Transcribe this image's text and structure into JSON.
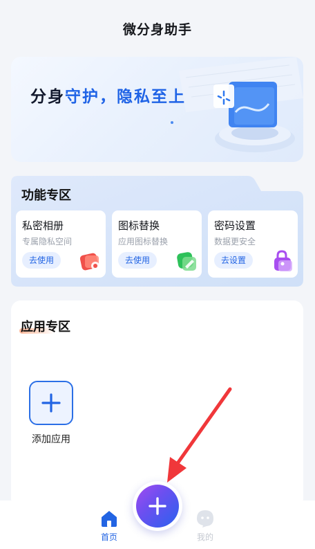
{
  "header": {
    "title": "微分身助手"
  },
  "banner": {
    "slogan_dark": "分身",
    "slogan_blue": "守护，隐私至上"
  },
  "functions": {
    "title": "功能专区",
    "items": [
      {
        "title": "私密相册",
        "subtitle": "专属隐私空间",
        "button": "去使用",
        "icon": "photo-album-icon",
        "color": "#f0504a"
      },
      {
        "title": "图标替换",
        "subtitle": "应用图标替换",
        "button": "去使用",
        "icon": "icon-replace-icon",
        "color": "#2ec15a"
      },
      {
        "title": "密码设置",
        "subtitle": "数据更安全",
        "button": "去设置",
        "icon": "lock-icon",
        "color": "#a84ef0"
      }
    ]
  },
  "apps": {
    "title": "应用专区",
    "add_label": "添加应用"
  },
  "tabbar": {
    "home": "首页",
    "mine": "我的"
  },
  "colors": {
    "accent": "#2264e3",
    "annotation_arrow": "#f0373a"
  }
}
